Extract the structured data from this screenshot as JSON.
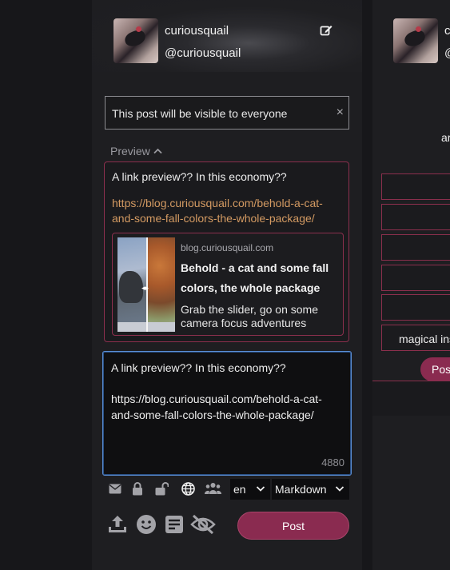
{
  "profile": {
    "display_name": "curiousquail",
    "handle": "@curiousquail"
  },
  "visibility_notice": {
    "text": "This post will be visible to everyone",
    "close_glyph": "×"
  },
  "preview": {
    "toggle_label": "Preview",
    "text": "A link preview?? In this economy??",
    "link": "https://blog.curiousquail.com/behold-a-cat-and-some-fall-colors-the-whole-package/",
    "card": {
      "domain": "blog.curiousquail.com",
      "title": "Behold - a cat and some fall colors, the whole package",
      "description": "Grab the slider, go on some camera focus adventures",
      "slider_handle": "◂▸"
    }
  },
  "compose": {
    "value": "A link preview?? In this economy?? \n\nhttps://blog.curiousquail.com/behold-a-cat-and-some-fall-colors-the-whole-package/",
    "char_count": "4880"
  },
  "toolbar": {
    "icons": [
      "envelope-icon",
      "lock-icon",
      "unlock-icon",
      "globe-icon",
      "group-icon"
    ],
    "language": "en",
    "format": "Markdown"
  },
  "actions": {
    "icons": [
      "upload-icon",
      "emoji-icon",
      "form-icon",
      "eye-slash-icon"
    ],
    "post_label": "Post"
  },
  "right_column": {
    "partial_name": "c",
    "partial_handle": "@",
    "partial_text": "ar",
    "field_text": "magical ins",
    "post_label": "Pos"
  },
  "colors": {
    "accent": "#8a2b50",
    "border_accent": "#8b2f4d",
    "link": "#d39a62",
    "focus": "#5b8fd6"
  }
}
